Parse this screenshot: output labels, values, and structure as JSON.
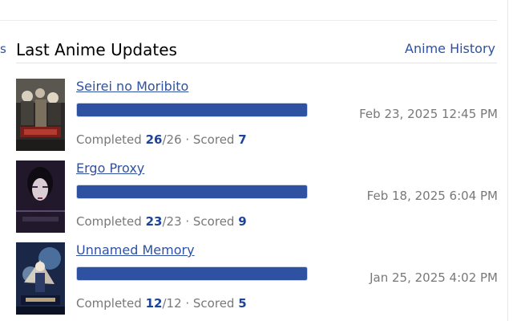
{
  "sidebar_fragment": "s",
  "section": {
    "title": "Last Anime Updates",
    "history_link": "Anime History"
  },
  "entries": [
    {
      "title": "Seirei no Moribito",
      "progress": 1.0,
      "date": "Feb 23, 2025 12:45 PM",
      "status": "Completed",
      "watched": "26",
      "total_sep": "/26",
      "scored_label": " · Scored ",
      "score": "7",
      "cover_colors": [
        "#3c3a36",
        "#c9c3b4",
        "#6b2a24"
      ]
    },
    {
      "title": "Ergo Proxy",
      "progress": 1.0,
      "date": "Feb 18, 2025 6:04 PM",
      "status": "Completed",
      "watched": "23",
      "total_sep": "/23",
      "scored_label": " · Scored ",
      "score": "9",
      "cover_colors": [
        "#1a1422",
        "#4a3a5e",
        "#d8d0d6"
      ]
    },
    {
      "title": "Unnamed Memory",
      "progress": 1.0,
      "date": "Jan 25, 2025 4:02 PM",
      "status": "Completed",
      "watched": "12",
      "total_sep": "/12",
      "scored_label": " · Scored ",
      "score": "5",
      "cover_colors": [
        "#1b2a4a",
        "#7aa7cf",
        "#e6d9c2"
      ]
    }
  ]
}
